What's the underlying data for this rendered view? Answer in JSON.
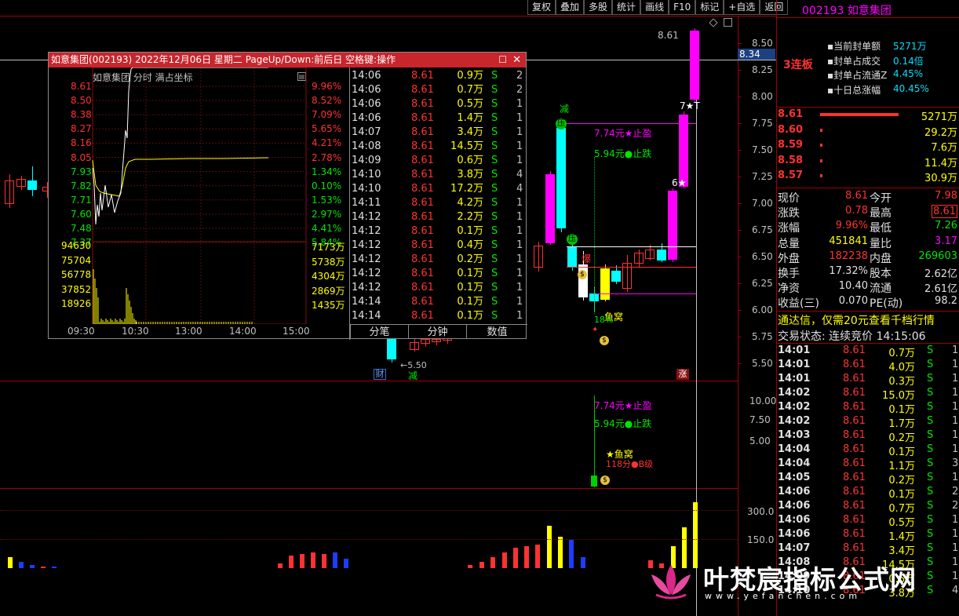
{
  "toolbar": [
    "复权",
    "叠加",
    "多股",
    "统计",
    "画线",
    "F10",
    "标记",
    "+自选",
    "返回"
  ],
  "stock": {
    "code": "002193",
    "name": "如意集团",
    "board": "3连板"
  },
  "seal": {
    "labels": [
      "当前封单额",
      "封单占成交",
      "封单占流通Z",
      "十日总涨幅"
    ],
    "values": [
      "5271万",
      "0.14倍",
      "4.45%",
      "40.45%"
    ]
  },
  "bids": [
    {
      "price": "8.61",
      "vol": "5271万"
    },
    {
      "price": "8.60",
      "vol": "29.2万"
    },
    {
      "price": "8.59",
      "vol": "7.6万"
    },
    {
      "price": "8.58",
      "vol": "11.4万"
    },
    {
      "price": "8.57",
      "vol": "30.9万"
    }
  ],
  "quote": [
    {
      "l1": "现价",
      "v1": "8.61",
      "l2": "今开",
      "v2": "7.98"
    },
    {
      "l1": "涨跌",
      "v1": "0.78",
      "l2": "最高",
      "v2": "8.61"
    },
    {
      "l1": "涨幅",
      "v1": "9.96%",
      "l2": "最低",
      "v2": "7.26"
    },
    {
      "l1": "总量",
      "v1": "451841",
      "l2": "量比",
      "v2": "3.17"
    },
    {
      "l1": "外盘",
      "v1": "182238",
      "l2": "内盘",
      "v2": "269603"
    },
    {
      "l1": "换手",
      "v1": "17.32%",
      "l2": "股本",
      "v2": "2.62亿"
    },
    {
      "l1": "净资",
      "v1": "10.40",
      "l2": "流通",
      "v2": "2.61亿"
    },
    {
      "l1": "收益(三)",
      "v1": "0.070",
      "l2": "PE(动)",
      "v2": "98.2"
    }
  ],
  "promo": "通达信，仅需20元查看千档行情",
  "trade_status": {
    "label": "交易状态: 连续竞价",
    "time": "14:15:06"
  },
  "right_ticks": [
    [
      "14:01",
      "8.61",
      "0.7万",
      "S",
      "1"
    ],
    [
      "14:01",
      "8.61",
      "4.0万",
      "S",
      "1"
    ],
    [
      "14:01",
      "8.61",
      "0.3万",
      "S",
      "1"
    ],
    [
      "14:02",
      "8.61",
      "15.0万",
      "S",
      "1"
    ],
    [
      "14:02",
      "8.61",
      "0.1万",
      "S",
      "1"
    ],
    [
      "14:02",
      "8.61",
      "1.7万",
      "S",
      "1"
    ],
    [
      "14:03",
      "8.61",
      "0.2万",
      "S",
      "1"
    ],
    [
      "14:04",
      "8.61",
      "0.1万",
      "S",
      "1"
    ],
    [
      "14:04",
      "8.61",
      "1.1万",
      "S",
      "3"
    ],
    [
      "14:05",
      "8.61",
      "0.2万",
      "S",
      "1"
    ],
    [
      "14:06",
      "8.61",
      "0.1万",
      "S",
      "2"
    ],
    [
      "14:06",
      "8.61",
      "0.7万",
      "S",
      "2"
    ],
    [
      "14:06",
      "8.61",
      "0.5万",
      "S",
      "1"
    ],
    [
      "14:06",
      "8.61",
      "1.4万",
      "S",
      "1"
    ],
    [
      "14:07",
      "8.61",
      "3.4万",
      "S",
      "1"
    ],
    [
      "14:08",
      "8.61",
      "14.5万",
      "S",
      "1"
    ],
    [
      "14:09",
      "8.61",
      "0.6万",
      "S",
      "1"
    ],
    [
      "14:10",
      "8.61",
      "3.8万",
      "S",
      "4"
    ]
  ],
  "price_axis": [
    "8.50",
    "8.25",
    "8.00",
    "7.75",
    "7.50",
    "7.25",
    "7.00",
    "6.75",
    "6.50",
    "6.25",
    "6.00",
    "5.75",
    "5.50"
  ],
  "current_price_tag": "8.34",
  "high_label": "8.61",
  "low_label": "5.50",
  "sub_axis": [
    "10.00",
    "7.50",
    "5.00"
  ],
  "vol_axis": [
    "300.0",
    "150.0"
  ],
  "annotations": {
    "take_profit": "7.74元★止盈",
    "stop_loss": "5.94元●止跌",
    "jian": "减",
    "ya": "压",
    "bao": "爆",
    "yuwo": "鱼窝",
    "pct18": "18%",
    "cai": "财",
    "zhang": "涨",
    "n7": "7★T",
    "n6": "6★",
    "sub_tp": "7.74元★止盈",
    "sub_sl": "5.94元●止跌",
    "sub_yuwo": "★鱼窝",
    "sub_score": "118分●B级"
  },
  "popup": {
    "title": "如意集团(002193) 2022年12月06日 星期二 PageUp/Down:前后日 空格键:操作",
    "header": "如意集团  分时 满占坐标",
    "prices": [
      "8.61",
      "8.50",
      "8.38",
      "8.27",
      "8.16",
      "8.05",
      "7.93",
      "7.82",
      "7.71",
      "7.60",
      "7.48",
      "7.37"
    ],
    "pcts": [
      "9.96%",
      "8.52%",
      "7.09%",
      "5.65%",
      "4.21%",
      "2.78%",
      "1.34%",
      "0.10%",
      "1.53%",
      "2.97%",
      "4.41%",
      "5.84%"
    ],
    "vols": [
      "94630",
      "75704",
      "56778",
      "37852",
      "18926"
    ],
    "amts": [
      "7173万",
      "5738万",
      "4304万",
      "2869万",
      "1435万"
    ],
    "times": [
      "09:30",
      "10:30",
      "13:00",
      "14:00",
      "15:00"
    ],
    "ticks": [
      [
        "14:06",
        "8.61",
        "0.9万",
        "S",
        "2"
      ],
      [
        "14:06",
        "8.61",
        "0.7万",
        "S",
        "2"
      ],
      [
        "14:06",
        "8.61",
        "0.5万",
        "S",
        "1"
      ],
      [
        "14:06",
        "8.61",
        "1.4万",
        "S",
        "1"
      ],
      [
        "14:07",
        "8.61",
        "3.4万",
        "S",
        "1"
      ],
      [
        "14:08",
        "8.61",
        "14.5万",
        "S",
        "1"
      ],
      [
        "14:09",
        "8.61",
        "0.6万",
        "S",
        "1"
      ],
      [
        "14:10",
        "8.61",
        "3.8万",
        "S",
        "4"
      ],
      [
        "14:10",
        "8.61",
        "17.2万",
        "S",
        "4"
      ],
      [
        "14:11",
        "8.61",
        "4.2万",
        "S",
        "1"
      ],
      [
        "14:12",
        "8.61",
        "2.2万",
        "S",
        "1"
      ],
      [
        "14:12",
        "8.61",
        "0.1万",
        "S",
        "1"
      ],
      [
        "14:12",
        "8.61",
        "0.4万",
        "S",
        "1"
      ],
      [
        "14:12",
        "8.61",
        "0.2万",
        "S",
        "1"
      ],
      [
        "14:12",
        "8.61",
        "0.1万",
        "S",
        "1"
      ],
      [
        "14:12",
        "8.61",
        "0.1万",
        "S",
        "1"
      ],
      [
        "14:14",
        "8.61",
        "0.1万",
        "S",
        "1"
      ],
      [
        "14:14",
        "8.61",
        "0.1万",
        "S",
        "1"
      ]
    ],
    "tabs": [
      "分笔",
      "分钟",
      "数值"
    ]
  },
  "watermark": {
    "title": "叶梵宸指标公式网",
    "url": "www.yefanchen.com"
  }
}
